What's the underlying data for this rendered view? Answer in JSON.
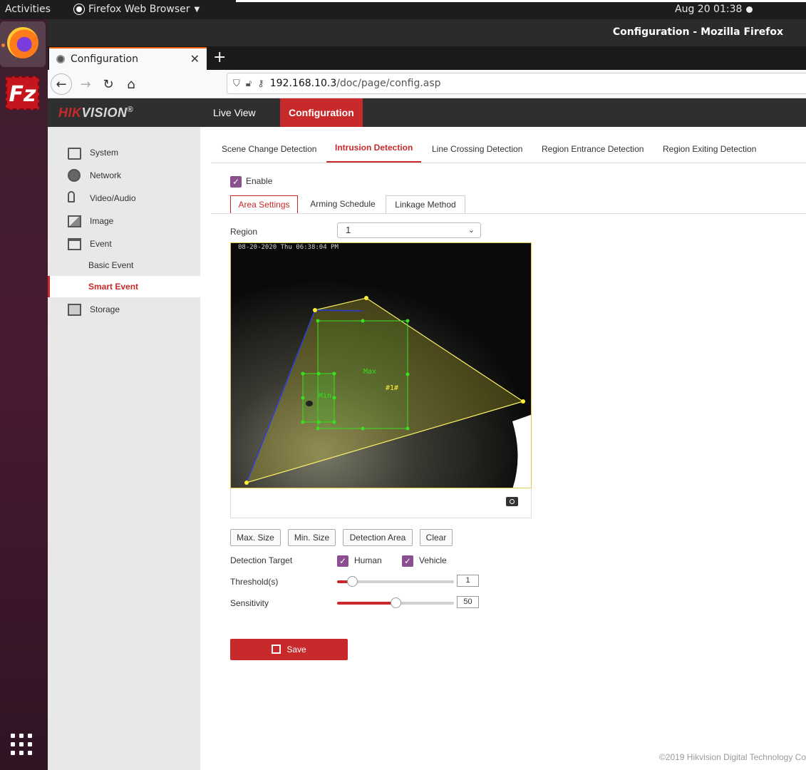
{
  "topbar": {
    "activities": "Activities",
    "app_name": "Firefox Web Browser",
    "clock": "Aug 20  01:38"
  },
  "window": {
    "title": "Configuration - Mozilla Firefox",
    "tab_title": "Configuration",
    "url_host": "192.168.10.3",
    "url_path": "/doc/page/config.asp"
  },
  "dock": {
    "filezilla_letters": "Fz"
  },
  "header": {
    "logo_hik": "HIK",
    "logo_vision": "VISION",
    "logo_reg": "®",
    "menu": [
      "Live View",
      "Configuration"
    ],
    "active_menu": "Configuration"
  },
  "sidebar": {
    "items": [
      {
        "label": "System",
        "icon": "system-icon"
      },
      {
        "label": "Network",
        "icon": "globe-icon"
      },
      {
        "label": "Video/Audio",
        "icon": "microphone-icon"
      },
      {
        "label": "Image",
        "icon": "image-icon"
      },
      {
        "label": "Event",
        "icon": "calendar-icon"
      },
      {
        "label": "Basic Event"
      },
      {
        "label": "Smart Event"
      },
      {
        "label": "Storage",
        "icon": "storage-icon"
      }
    ],
    "active": "Smart Event"
  },
  "detection_tabs": [
    "Scene Change Detection",
    "Intrusion Detection",
    "Line Crossing Detection",
    "Region Entrance Detection",
    "Region Exiting Detection"
  ],
  "active_detection_tab": "Intrusion Detection",
  "enable_label": "Enable",
  "enabled": true,
  "steps": [
    "Area Settings",
    "Arming Schedule",
    "Linkage Method"
  ],
  "active_step": "Area Settings",
  "region": {
    "label": "Region",
    "value": "1"
  },
  "video": {
    "timestamp": "08-20-2020 Thu 06:38:04 PM",
    "max_label": "Max",
    "min_label": "Min",
    "region_label": "#1#"
  },
  "area_buttons": [
    "Max. Size",
    "Min. Size",
    "Detection Area",
    "Clear"
  ],
  "detection_target": {
    "label": "Detection Target",
    "human": "Human",
    "vehicle": "Vehicle",
    "human_checked": true,
    "vehicle_checked": true
  },
  "threshold": {
    "label": "Threshold(s)",
    "value": "1",
    "fraction": 0.13
  },
  "sensitivity": {
    "label": "Sensitivity",
    "value": "50",
    "fraction": 0.5
  },
  "save_label": "Save",
  "copyright": "©2019 Hikvision Digital Technology Co",
  "colors": {
    "accent": "#c8292b",
    "checkbox": "#8b4f8f",
    "header": "#2f2f2f"
  }
}
